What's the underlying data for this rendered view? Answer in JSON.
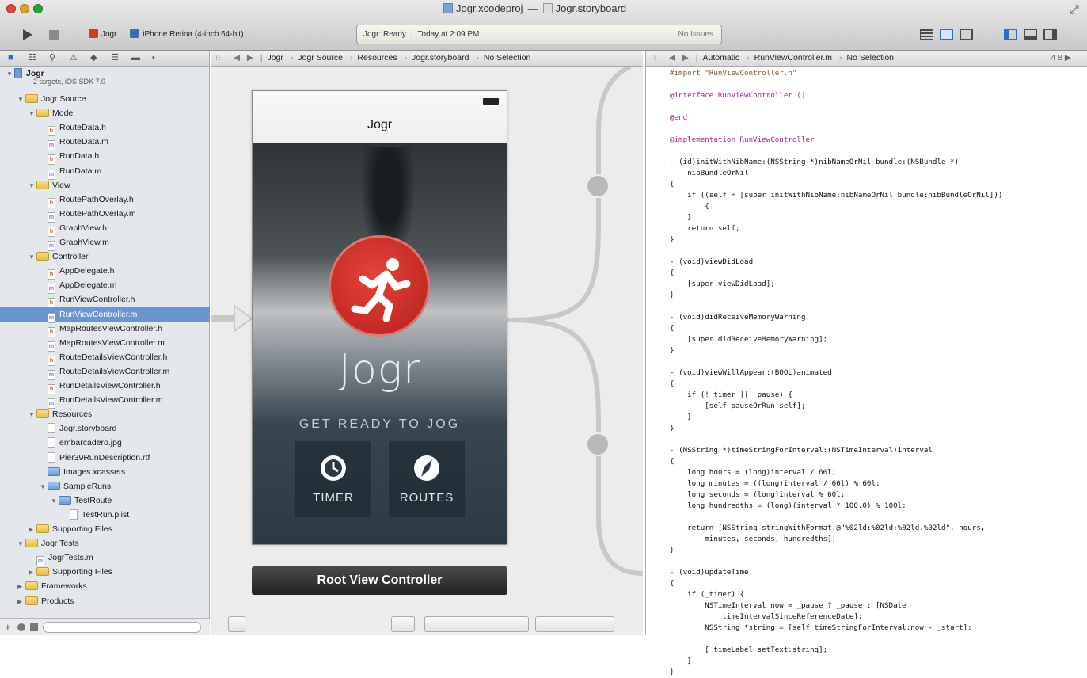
{
  "window": {
    "title_project": "Jogr.xcodeproj",
    "title_sep": "—",
    "title_file": "Jogr.storyboard"
  },
  "toolbar": {
    "scheme": "Jogr",
    "destination": "iPhone Retina (4-inch 64-bit)",
    "status": "Jogr: Ready",
    "status_time": "Today at 2:09 PM",
    "issues": "No Issues"
  },
  "navigator": {
    "project_name": "Jogr",
    "project_sub": "2 targets, iOS SDK 7.0",
    "items": [
      {
        "label": "Jogr Source",
        "indent": 1,
        "kind": "folder",
        "open": true
      },
      {
        "label": "Model",
        "indent": 2,
        "kind": "folder",
        "open": true
      },
      {
        "label": "RouteData.h",
        "indent": 3,
        "kind": "h"
      },
      {
        "label": "RouteData.m",
        "indent": 3,
        "kind": "m"
      },
      {
        "label": "RunData.h",
        "indent": 3,
        "kind": "h"
      },
      {
        "label": "RunData.m",
        "indent": 3,
        "kind": "m"
      },
      {
        "label": "View",
        "indent": 2,
        "kind": "folder",
        "open": true
      },
      {
        "label": "RoutePathOverlay.h",
        "indent": 3,
        "kind": "h"
      },
      {
        "label": "RoutePathOverlay.m",
        "indent": 3,
        "kind": "m"
      },
      {
        "label": "GraphView.h",
        "indent": 3,
        "kind": "h"
      },
      {
        "label": "GraphView.m",
        "indent": 3,
        "kind": "m"
      },
      {
        "label": "Controller",
        "indent": 2,
        "kind": "folder",
        "open": true
      },
      {
        "label": "AppDelegate.h",
        "indent": 3,
        "kind": "h"
      },
      {
        "label": "AppDelegate.m",
        "indent": 3,
        "kind": "m"
      },
      {
        "label": "RunViewController.h",
        "indent": 3,
        "kind": "h"
      },
      {
        "label": "RunViewController.m",
        "indent": 3,
        "kind": "m",
        "selected": true
      },
      {
        "label": "MapRoutesViewController.h",
        "indent": 3,
        "kind": "h"
      },
      {
        "label": "MapRoutesViewController.m",
        "indent": 3,
        "kind": "m"
      },
      {
        "label": "RouteDetailsViewController.h",
        "indent": 3,
        "kind": "h"
      },
      {
        "label": "RouteDetailsViewController.m",
        "indent": 3,
        "kind": "m"
      },
      {
        "label": "RunDetailsViewController.h",
        "indent": 3,
        "kind": "h"
      },
      {
        "label": "RunDetailsViewController.m",
        "indent": 3,
        "kind": "m"
      },
      {
        "label": "Resources",
        "indent": 2,
        "kind": "folder",
        "open": true
      },
      {
        "label": "Jogr.storyboard",
        "indent": 3,
        "kind": "sb"
      },
      {
        "label": "embarcadero.jpg",
        "indent": 3,
        "kind": "img"
      },
      {
        "label": "Pier39RunDescription.rtf",
        "indent": 3,
        "kind": "rtf"
      },
      {
        "label": "Images.xcassets",
        "indent": 3,
        "kind": "bluefolder"
      },
      {
        "label": "SampleRuns",
        "indent": 3,
        "kind": "bluefolder",
        "open": true
      },
      {
        "label": "TestRoute",
        "indent": 4,
        "kind": "bluefolder",
        "open": true
      },
      {
        "label": "TestRun.plist",
        "indent": 5,
        "kind": "plist"
      },
      {
        "label": "Supporting Files",
        "indent": 2,
        "kind": "folder",
        "open": false
      },
      {
        "label": "Jogr Tests",
        "indent": 1,
        "kind": "folder",
        "open": true
      },
      {
        "label": "JogrTests.m",
        "indent": 2,
        "kind": "m"
      },
      {
        "label": "Supporting Files",
        "indent": 2,
        "kind": "folder",
        "open": false
      },
      {
        "label": "Frameworks",
        "indent": 1,
        "kind": "folder",
        "open": false
      },
      {
        "label": "Products",
        "indent": 1,
        "kind": "folder",
        "open": false
      }
    ]
  },
  "jumpbar_left": [
    "Jogr",
    "Jogr Source",
    "Resources",
    "Jogr.storyboard",
    "No Selection"
  ],
  "jumpbar_right": [
    "Automatic",
    "RunViewController.m",
    "No Selection"
  ],
  "jumpbar_right_counter": "4 8 ▶",
  "storyboard": {
    "nav_title": "Jogr",
    "logo": "Jogr",
    "tagline": "GET READY TO JOG",
    "timer_label": "TIMER",
    "routes_label": "ROUTES",
    "root_label": "Root View Controller"
  },
  "code_lines": [
    "#import \"RunViewController.h\"",
    "",
    "@interface RunViewController ()",
    "",
    "@end",
    "",
    "@implementation RunViewController",
    "",
    "- (id)initWithNibName:(NSString *)nibNameOrNil bundle:(NSBundle *)",
    "    nibBundleOrNil",
    "{",
    "    if ((self = [super initWithNibName:nibNameOrNil bundle:nibBundleOrNil]))",
    "        {",
    "    }",
    "    return self;",
    "}",
    "",
    "- (void)viewDidLoad",
    "{",
    "    [super viewDidLoad];",
    "}",
    "",
    "- (void)didReceiveMemoryWarning",
    "{",
    "    [super didReceiveMemoryWarning];",
    "}",
    "",
    "- (void)viewWillAppear:(BOOL)animated",
    "{",
    "    if (!_timer || _pause) {",
    "        [self pauseOrRun:self];",
    "    }",
    "}",
    "",
    "- (NSString *)timeStringForInterval:(NSTimeInterval)interval",
    "{",
    "    long hours = (long)interval / 60l;",
    "    long minutes = ((long)interval / 60l) % 60l;",
    "    long seconds = (long)interval % 60l;",
    "    long hundredths = (long)(interval * 100.0) % 100l;",
    "",
    "    return [NSString stringWithFormat:@\"%02ld:%02ld:%02ld.%02ld\", hours,",
    "        minutes, seconds, hundredths];",
    "}",
    "",
    "- (void)updateTime",
    "{",
    "    if (_timer) {",
    "        NSTimeInterval now = _pause ? _pause : [NSDate",
    "            timeIntervalSinceReferenceDate];",
    "        NSString *string = [self timeStringForInterval:now - _start];",
    "",
    "        [_timeLabel setText:string];",
    "    }",
    "}"
  ]
}
